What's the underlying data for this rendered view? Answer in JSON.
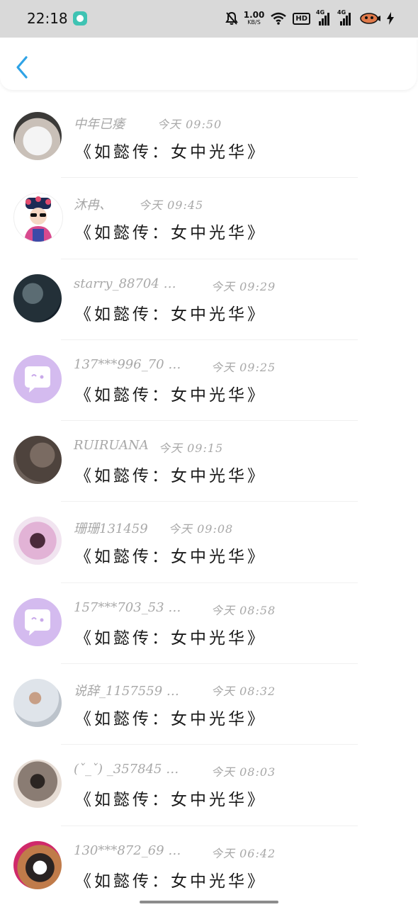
{
  "status_bar": {
    "time": "22:18",
    "speed_value": "1.00",
    "speed_unit": "KB/S",
    "hd_label": "HD",
    "net1": "4G",
    "net2": "4G",
    "icons": [
      "bell-off-icon",
      "wifi-icon",
      "signal-icon",
      "signal-icon",
      "battery-icon",
      "charging-icon"
    ]
  },
  "header": {
    "back_icon": "chevron-left-icon",
    "accent": "#2fa3e6"
  },
  "comments": [
    {
      "name": "中年已痿",
      "time": "今天 09:50",
      "text": "《如懿传：女中光华》",
      "avatar": "dog"
    },
    {
      "name": "沐冉、",
      "time": "今天 09:45",
      "text": "《如懿传：女中光华》",
      "avatar": "queen"
    },
    {
      "name": "starry_88704 …",
      "time": "今天 09:29",
      "text": "《如懿传：女中光华》",
      "avatar": "dark"
    },
    {
      "name": "137***996_70 …",
      "time": "今天 09:25",
      "text": "《如懿传：女中光华》",
      "avatar": "chat"
    },
    {
      "name": "RUIRUANA",
      "time": "今天 09:15",
      "text": "《如懿传：女中光华》",
      "avatar": "cat"
    },
    {
      "name": "珊珊131459",
      "time": "今天 09:08",
      "text": "《如懿传：女中光华》",
      "avatar": "girl"
    },
    {
      "name": "157***703_53 …",
      "time": "今天 08:58",
      "text": "《如懿传：女中光华》",
      "avatar": "chat"
    },
    {
      "name": "说辞_1157559 …",
      "time": "今天 08:32",
      "text": "《如懿传：女中光华》",
      "avatar": "boy"
    },
    {
      "name": "(ˇ_ˇ) _357845 …",
      "time": "今天 08:03",
      "text": "《如懿传：女中光华》",
      "avatar": "blur"
    },
    {
      "name": "130***872_69 …",
      "time": "今天 06:42",
      "text": "《如懿传：女中光华》",
      "avatar": "calico"
    }
  ]
}
